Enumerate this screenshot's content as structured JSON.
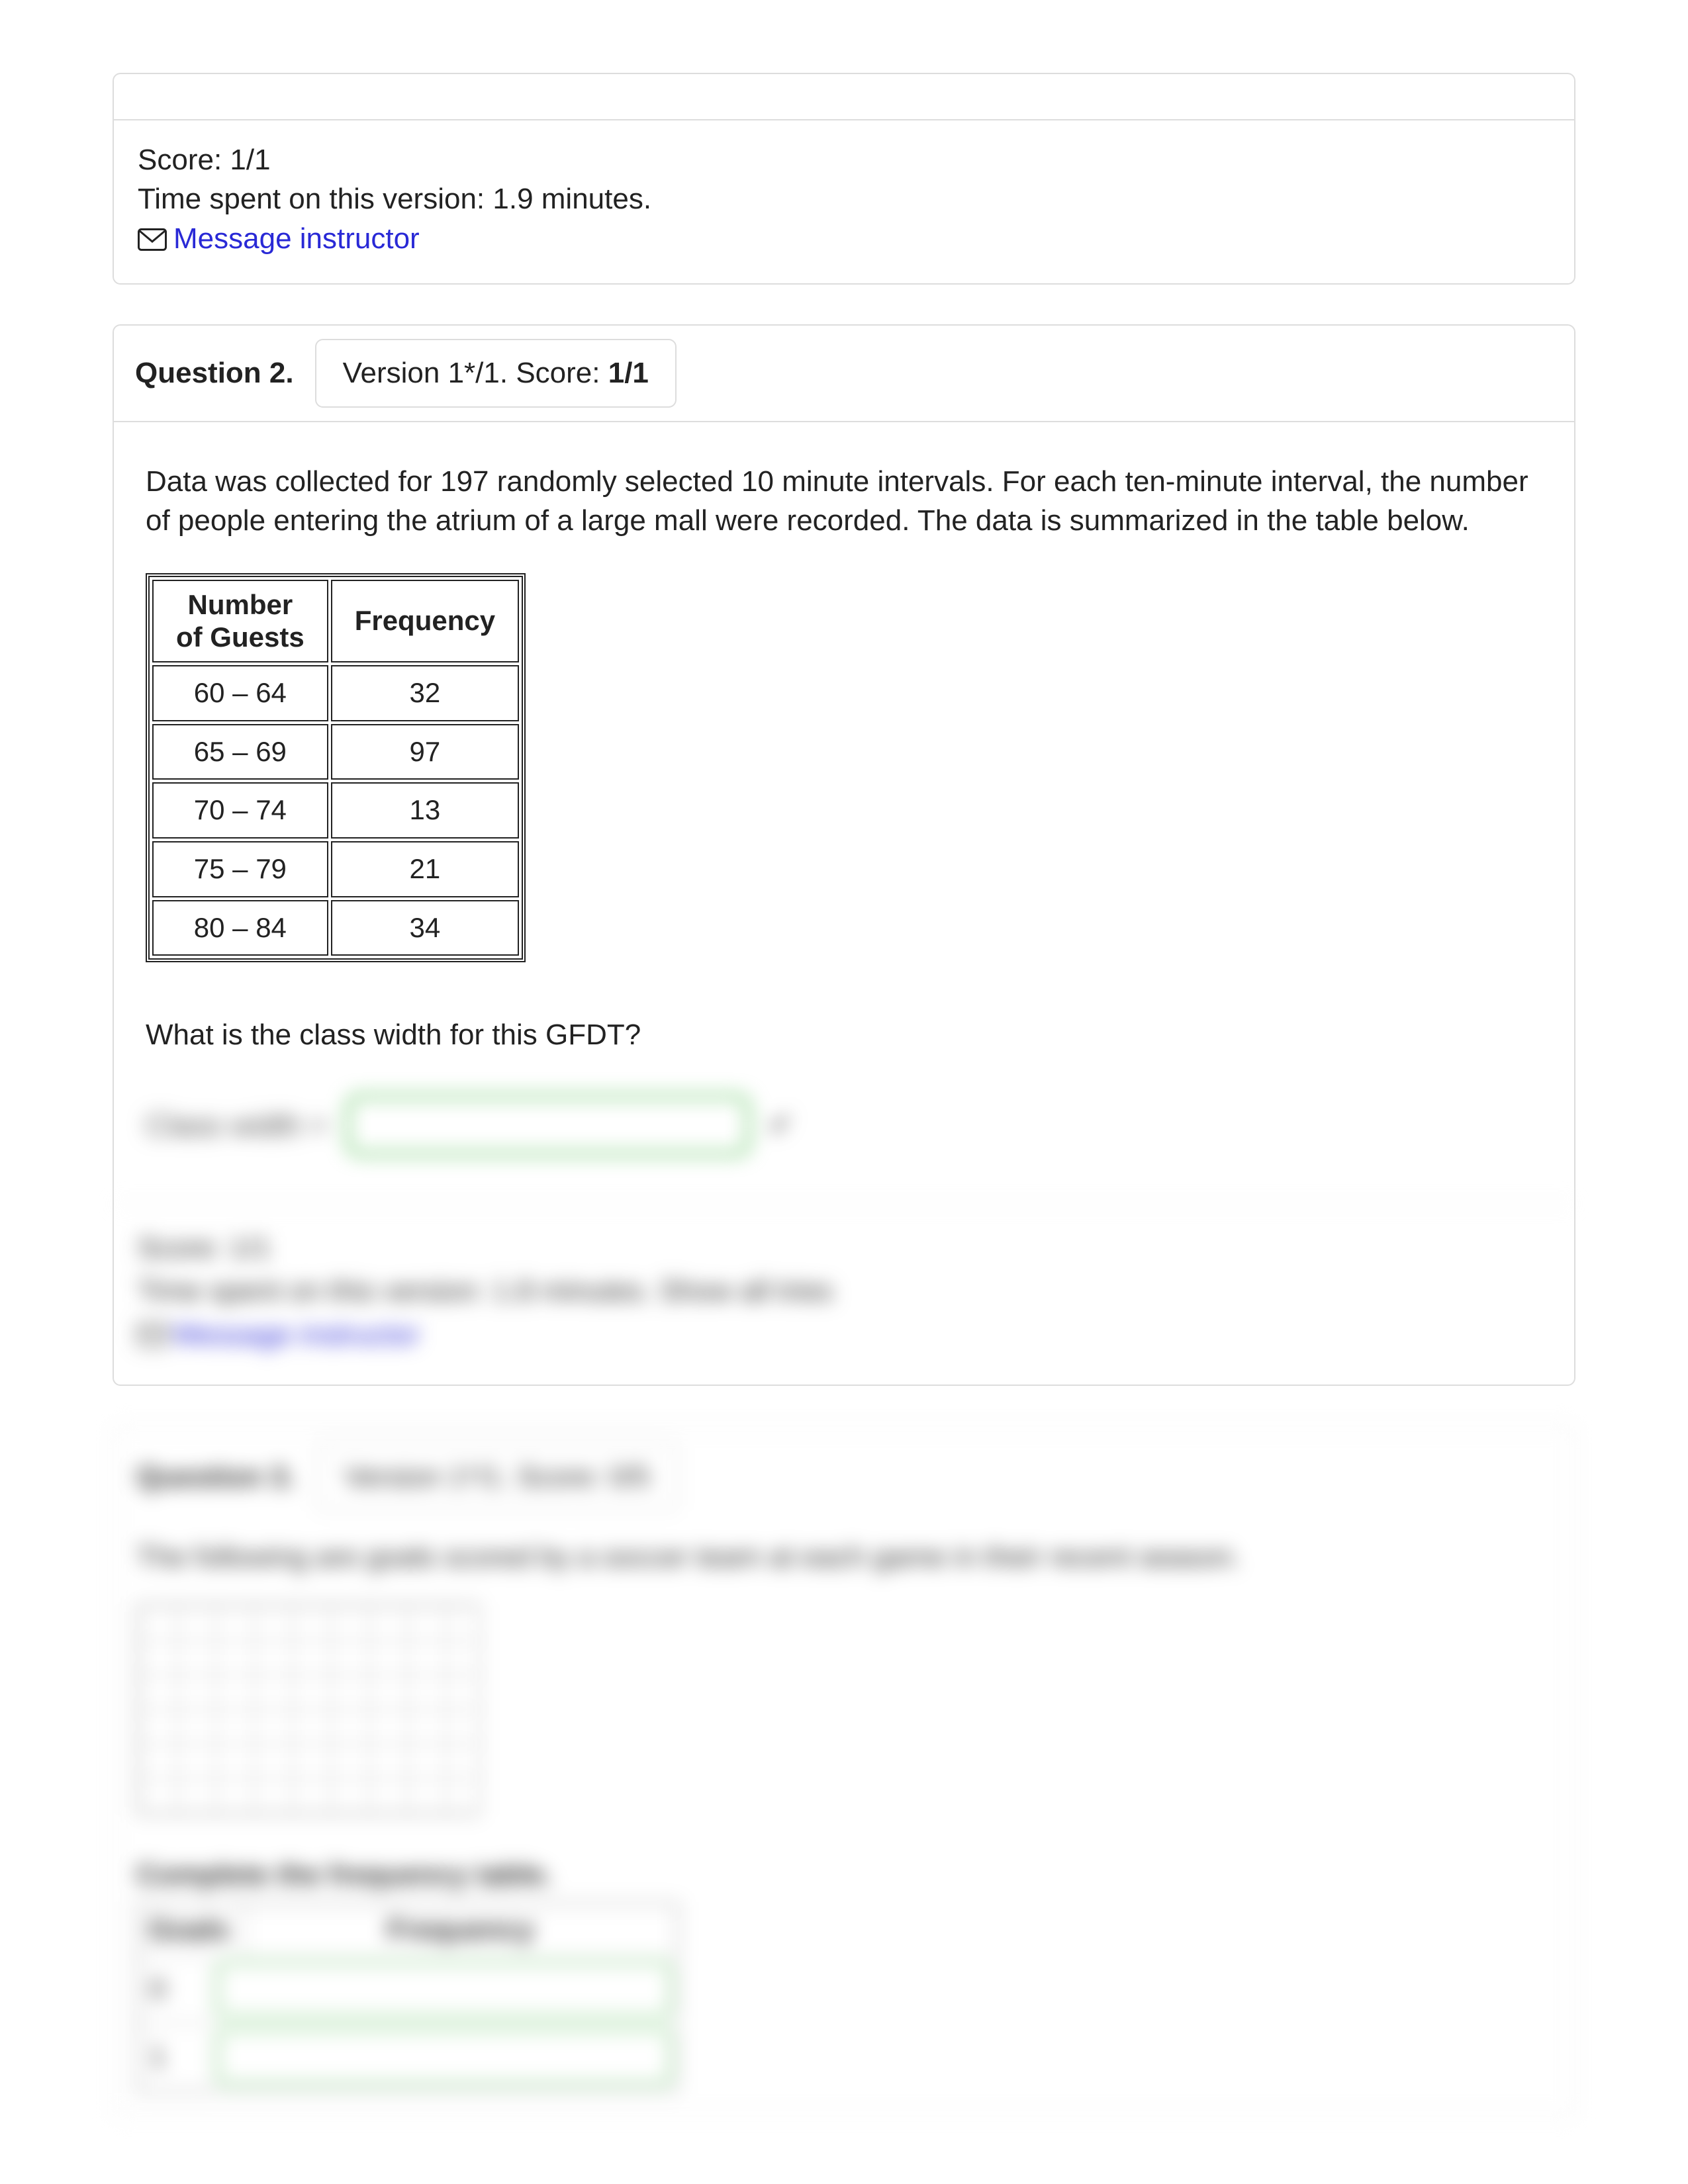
{
  "prev_card": {
    "score_line": "Score: 1/1",
    "time_line": "Time spent on this version: 1.9 minutes.",
    "msg_link": "Message instructor"
  },
  "q2": {
    "title": "Question 2.",
    "version_prefix": "Version 1*/1. Score: ",
    "version_score": "1/1",
    "prompt": "Data was collected for 197 randomly selected 10 minute intervals. For each ten-minute interval, the number of people entering the atrium of a large mall were recorded. The data is summarized in the table below.",
    "table_headers": {
      "col1_line1": "Number",
      "col1_line2": "of Guests",
      "col2": "Frequency"
    },
    "rows": [
      {
        "range": "60 – 64",
        "freq": "32"
      },
      {
        "range": "65 – 69",
        "freq": "97"
      },
      {
        "range": "70 – 74",
        "freq": "13"
      },
      {
        "range": "75 – 79",
        "freq": "21"
      },
      {
        "range": "80 – 84",
        "freq": "34"
      }
    ],
    "question_line": "What is the class width for this GFDT?",
    "answer_label": "Class width ="
  },
  "blur": {
    "score_line": "Score: 1/1",
    "time_line": "Time spent on this version: 1.8 minutes.    Show all tries",
    "msg_link": "Message instructor",
    "q3_title": "Question 3.",
    "q3_version": "Version 1*/1. Score: 0/5",
    "q3_prompt": "The following are goals scored by a soccer team at each game in their recent season.",
    "q3_instruction": "Complete the frequency table.",
    "mini_hdr1": "Goals",
    "mini_hdr2": "Frequency",
    "mini_lab1": "0",
    "mini_lab2": "1"
  }
}
